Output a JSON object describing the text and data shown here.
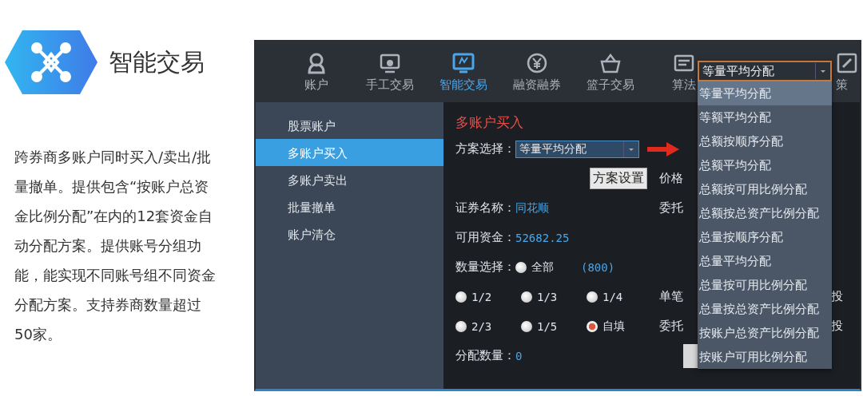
{
  "intro": {
    "title": "智能交易",
    "description": "跨券商多账户同时买入/卖出/批量撤单。提供包含“按账户总资金比例分配”在内的12套资金自动分配方案。提供账号分组功能，能实现不同账号组不同资金分配方案。支持券商数量超过50家。"
  },
  "toolbar": [
    {
      "label": "账户",
      "selected": false
    },
    {
      "label": "手工交易",
      "selected": false
    },
    {
      "label": "智能交易",
      "selected": true
    },
    {
      "label": "融资融券",
      "selected": false
    },
    {
      "label": "篮子交易",
      "selected": false
    },
    {
      "label": "算法",
      "selected": false
    },
    {
      "label": "策",
      "selected": false
    }
  ],
  "sidebar": {
    "items": [
      {
        "label": "股票账户",
        "selected": false
      },
      {
        "label": "多账户买入",
        "selected": true
      },
      {
        "label": "多账户卖出",
        "selected": false
      },
      {
        "label": "批量撤单",
        "selected": false
      },
      {
        "label": "账户清仓",
        "selected": false
      }
    ]
  },
  "form": {
    "title": "多账户买入",
    "scheme_label": "方案选择：",
    "scheme_value": "等量平均分配",
    "settings_button": "方案设置",
    "fields": [
      {
        "label": "证券名称：",
        "value": "同花顺"
      },
      {
        "label": "可用资金：",
        "value": "52682.25"
      }
    ],
    "quantity_label": "数量选择：",
    "all_count": "(800)",
    "radios": [
      {
        "label": "全部",
        "selected": false
      },
      {
        "label": "1/2",
        "selected": false
      },
      {
        "label": "1/3",
        "selected": false
      },
      {
        "label": "1/4",
        "selected": false
      },
      {
        "label": "2/3",
        "selected": false
      },
      {
        "label": "1/5",
        "selected": false
      },
      {
        "label": "自填",
        "selected": true
      }
    ],
    "allocated_label": "分配数量：",
    "allocated_value": "0",
    "right_labels": [
      "价格",
      "委托",
      "单笔",
      "委托"
    ],
    "right_suffixes": [
      "投",
      "投"
    ]
  },
  "dropdown": {
    "value": "等量平均分配",
    "options": [
      {
        "label": "等量平均分配",
        "selected": true
      },
      {
        "label": "等额平均分配",
        "selected": false
      },
      {
        "label": "总额按顺序分配",
        "selected": false
      },
      {
        "label": "总额平均分配",
        "selected": false
      },
      {
        "label": "总额按可用比例分配",
        "selected": false
      },
      {
        "label": "总额按总资产比例分配",
        "selected": false
      },
      {
        "label": "总量按顺序分配",
        "selected": false
      },
      {
        "label": "总量平均分配",
        "selected": false
      },
      {
        "label": "总量按可用比例分配",
        "selected": false
      },
      {
        "label": "总量按总资产比例分配",
        "selected": false
      },
      {
        "label": "按账户总资产比例分配",
        "selected": false
      },
      {
        "label": "按账户可用比例分配",
        "selected": false
      }
    ]
  }
}
